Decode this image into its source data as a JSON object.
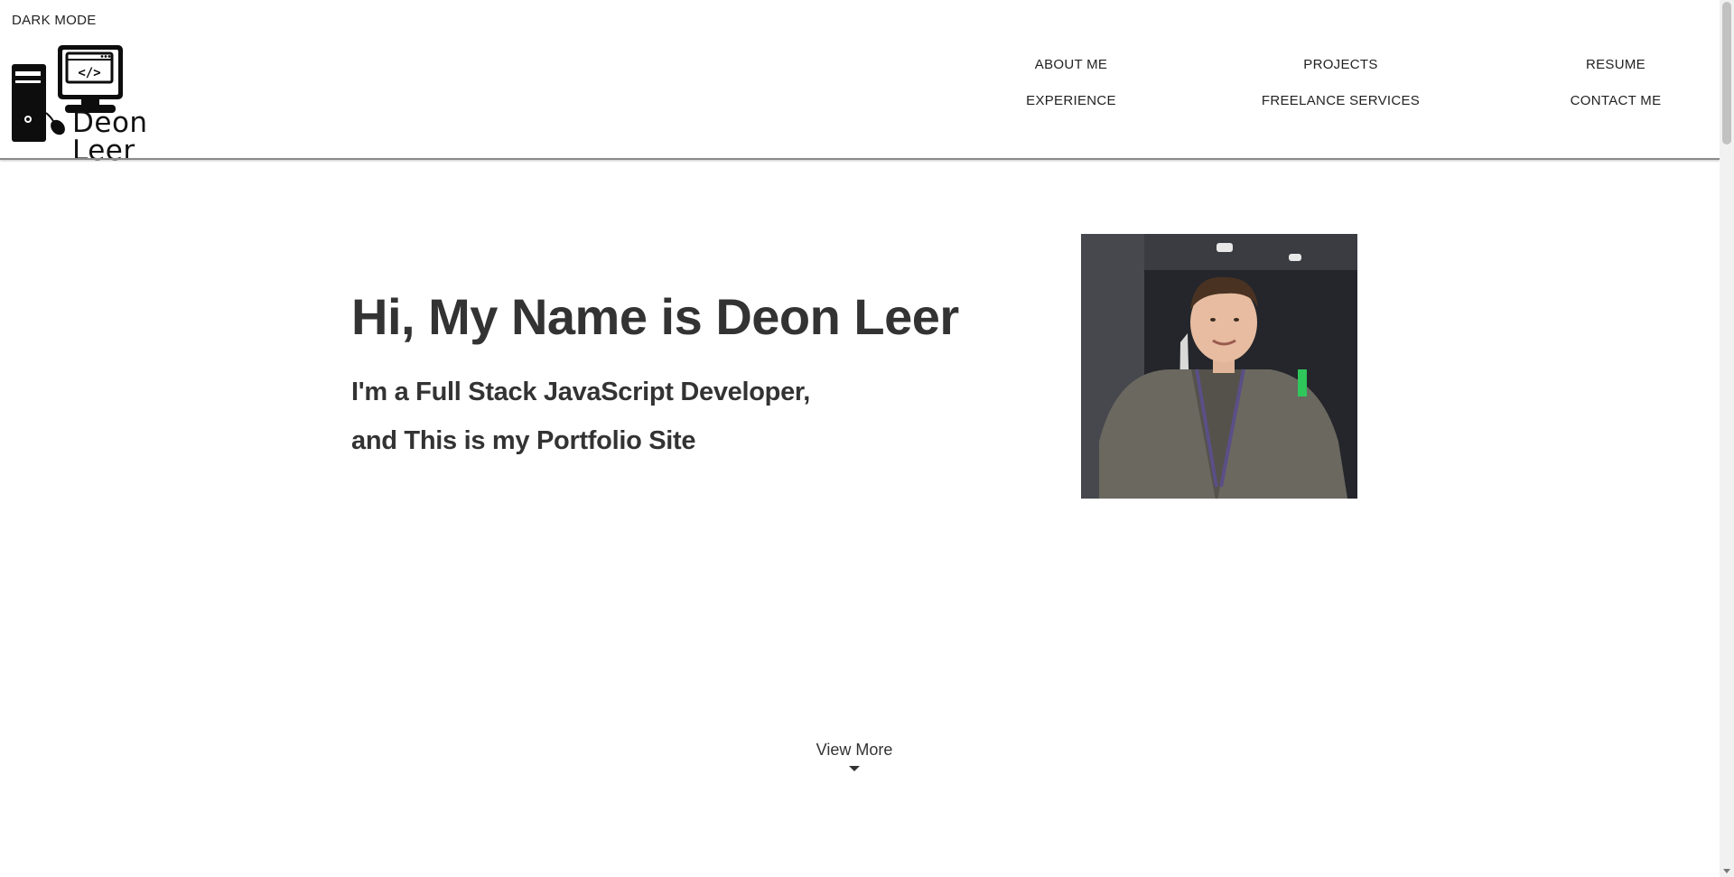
{
  "header": {
    "dark_mode_label": "DARK MODE",
    "logo_text": "Deon Leer",
    "nav": [
      {
        "label": "ABOUT ME"
      },
      {
        "label": "PROJECTS"
      },
      {
        "label": "RESUME"
      },
      {
        "label": "EXPERIENCE"
      },
      {
        "label": "FREELANCE SERVICES"
      },
      {
        "label": "CONTACT ME"
      }
    ]
  },
  "hero": {
    "title": "Hi, My Name is Deon Leer",
    "subtitle_line1": "I'm a Full Stack JavaScript Developer,",
    "subtitle_line2": "and This is my Portfolio Site",
    "photo_icon": "profile-photo"
  },
  "view_more": {
    "label": "View More",
    "icon": "caret-down-icon"
  },
  "colors": {
    "text": "#333333",
    "background": "#ffffff",
    "rule": "#8a8a8a"
  }
}
